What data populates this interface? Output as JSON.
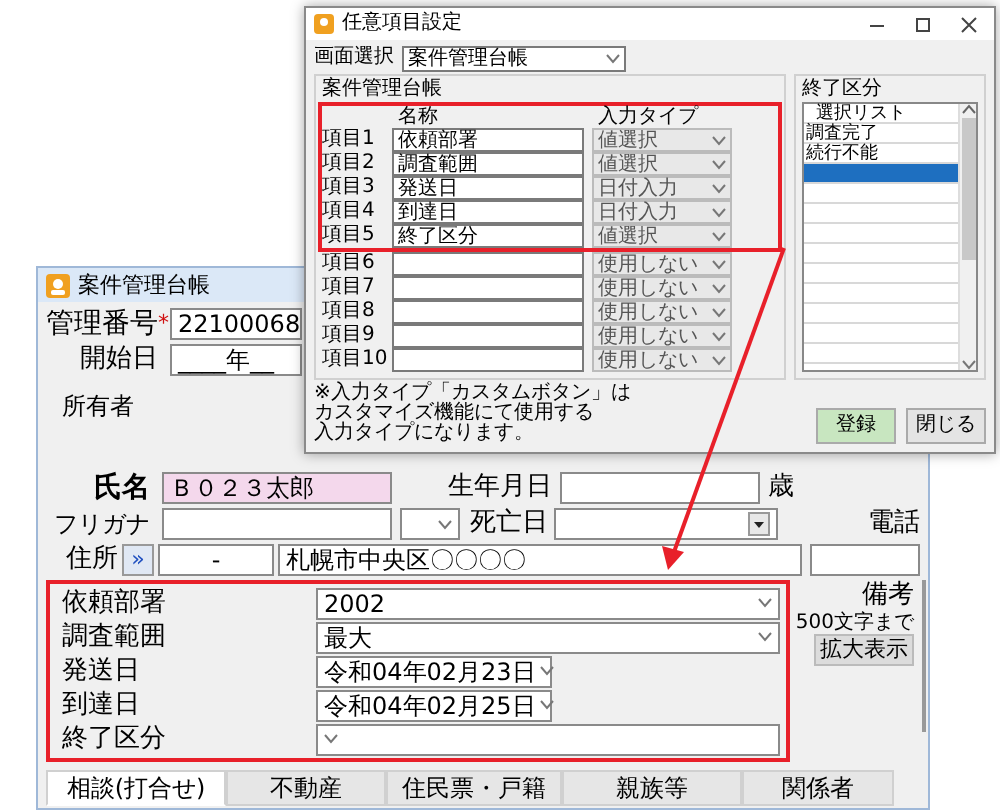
{
  "dialog": {
    "title": "任意項目設定",
    "screen_label": "画面選択",
    "screen_value": "案件管理台帳",
    "group_title": "案件管理台帳",
    "col_name": "名称",
    "col_type": "入力タイプ",
    "items": [
      {
        "label": "項目1",
        "name": "依頼部署",
        "type": "値選択",
        "highlighted": true
      },
      {
        "label": "項目2",
        "name": "調査範囲",
        "type": "値選択",
        "highlighted": true
      },
      {
        "label": "項目3",
        "name": "発送日",
        "type": "日付入力",
        "highlighted": true
      },
      {
        "label": "項目4",
        "name": "到達日",
        "type": "日付入力",
        "highlighted": true
      },
      {
        "label": "項目5",
        "name": "終了区分",
        "type": "値選択",
        "highlighted": true
      },
      {
        "label": "項目6",
        "type": "使用しない",
        "highlighted": false
      },
      {
        "label": "項目7",
        "type": "使用しない",
        "highlighted": false
      },
      {
        "label": "項目8",
        "type": "使用しない",
        "highlighted": false
      },
      {
        "label": "項目9",
        "type": "使用しない",
        "highlighted": false
      },
      {
        "label": "項目10",
        "type": "使用しない",
        "highlighted": false
      }
    ],
    "list_title": "終了区分",
    "list_header": "選択リスト",
    "list_rows": [
      {
        "text": "調査完了",
        "selected": false
      },
      {
        "text": "続行不能",
        "selected": false
      },
      {
        "selected": true
      },
      {
        "selected": false
      },
      {
        "selected": false
      },
      {
        "selected": false
      },
      {
        "selected": false
      },
      {
        "selected": false
      },
      {
        "selected": false
      },
      {
        "selected": false
      },
      {
        "selected": false
      },
      {
        "selected": false
      }
    ],
    "note": [
      "※入力タイプ「カスタムボタン」は",
      "カスタマイズ機能にて使用する",
      "入力タイプになります。"
    ],
    "buttons": [
      {
        "label": "登録",
        "kind": "primary"
      },
      {
        "label": "閉じる",
        "kind": "normal"
      }
    ]
  },
  "main": {
    "title": "案件管理台帳",
    "number_label": "管理番号",
    "required_mark": "*",
    "number_value": "22100068",
    "start_label": "開始日",
    "start_value": "____年__",
    "owner_group": "所有者",
    "name_label": "氏名",
    "name_value": "Ｂ０２３太郎",
    "birth_label": "生年月日",
    "age_label": "歳",
    "kana_label": "フリガナ",
    "death_label": "死亡日",
    "phone_label": "電話",
    "address_label": "住所",
    "address_button": "»",
    "postal_value": "-",
    "address_value": "札幌市中央区〇〇〇〇",
    "custom_rows": [
      {
        "label": "依頼部署",
        "value": "2002",
        "kind": "select"
      },
      {
        "label": "調査範囲",
        "value": "最大",
        "kind": "select"
      },
      {
        "label": "発送日",
        "value": "令和04年02月23日",
        "kind": "date"
      },
      {
        "label": "到達日",
        "value": "令和04年02月25日",
        "kind": "date"
      },
      {
        "label": "終了区分",
        "kind": "select"
      }
    ],
    "memo_label": "備考",
    "memo_hint": "500文字まで",
    "memo_button": "拡大表示",
    "tabs": [
      {
        "label": "相談(打合せ)",
        "selected": true
      },
      {
        "label": "不動産",
        "selected": false
      },
      {
        "label": "住民票・戸籍",
        "selected": false
      },
      {
        "label": "親族等",
        "selected": false
      },
      {
        "label": "関係者",
        "selected": false
      }
    ]
  }
}
